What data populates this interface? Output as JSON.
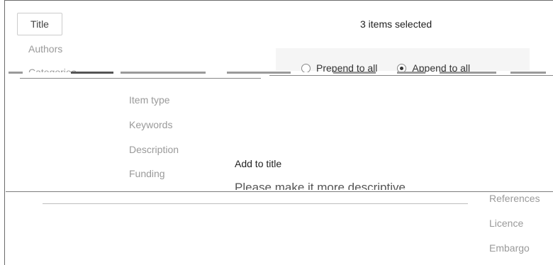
{
  "left_fields": {
    "title_button": "Title",
    "authors": "Authors",
    "categories": "Categories",
    "item_type": "Item type",
    "keywords": "Keywords",
    "description": "Description",
    "funding": "Funding"
  },
  "right_fields": {
    "references": "References",
    "licence": "Licence",
    "embargo": "Embargo"
  },
  "selection": {
    "count_text": "3 items selected"
  },
  "mode": {
    "prepend_label": "Prepend to all",
    "append_label": "Append to all",
    "selected": "append"
  },
  "editor": {
    "add_label": "Add to title",
    "hint": "Please make it more descriptive"
  }
}
